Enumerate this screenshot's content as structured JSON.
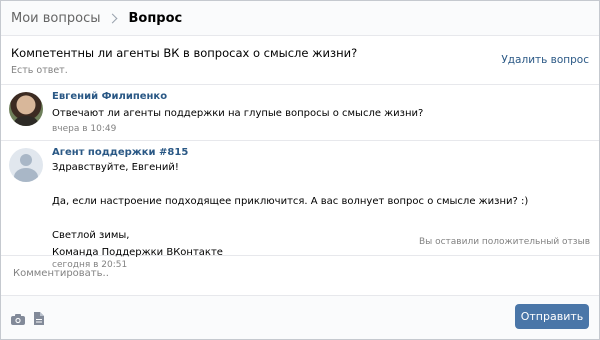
{
  "breadcrumb": {
    "parent": "Мои вопросы",
    "current": "Вопрос"
  },
  "question": {
    "title": "Компетентны ли агенты ВК в вопросах о смысле жизни?",
    "status": "Есть ответ.",
    "delete_label": "Удалить вопрос"
  },
  "messages": [
    {
      "author": "Евгений Филипенко",
      "lines": [
        "Отвечают ли агенты поддержки на глупые вопросы о смысле жизни?"
      ],
      "time": "вчера в 10:49"
    },
    {
      "author": "Агент поддержки #815",
      "lines": [
        "Здравствуйте, Евгений!",
        "",
        "Да, если настроение подходящее приключится. А вас волнует вопрос о смысле жизни? :)",
        "",
        "Светлой зимы,",
        "Команда Поддержки ВКонтакте"
      ],
      "time": "сегодня в 20:51",
      "feedback": "Вы оставили положительный отзыв"
    }
  ],
  "comment": {
    "placeholder": "Комментировать.."
  },
  "footer": {
    "send_label": "Отправить",
    "icons": [
      "camera-icon",
      "document-icon"
    ]
  },
  "colors": {
    "link": "#2a5885",
    "button": "#4a76a8",
    "muted": "#828282"
  }
}
